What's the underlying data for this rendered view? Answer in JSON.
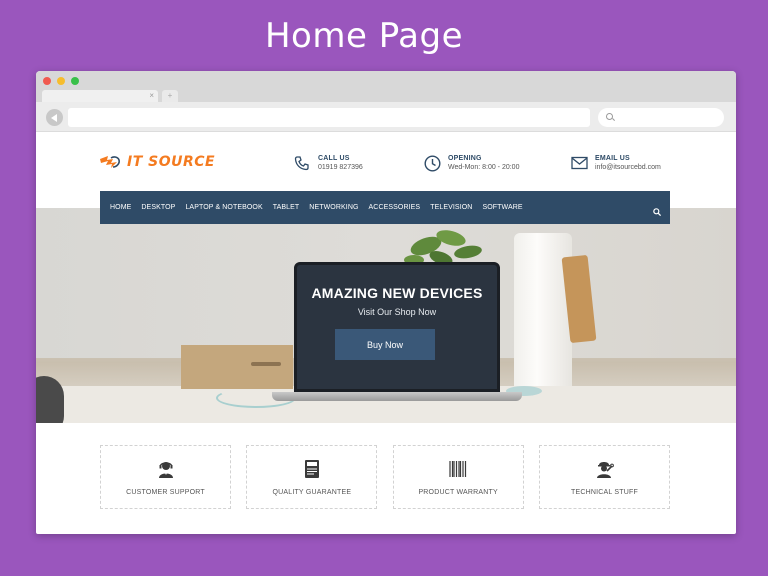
{
  "heading": "Home Page",
  "browser": {
    "tab_close": "×",
    "tab_new": "+"
  },
  "site": {
    "logo": {
      "mark": "ITS",
      "text": "IT SOURCE",
      "color": "#f47b20"
    },
    "contacts": [
      {
        "icon": "phone-icon",
        "label": "CALL US",
        "value": "01919 827396"
      },
      {
        "icon": "clock-icon",
        "label": "OPENING",
        "value": "Wed-Mon: 8:00 - 20:00"
      },
      {
        "icon": "envelope-icon",
        "label": "EMAIL US",
        "value": "info@itsourcebd.com"
      }
    ],
    "nav": {
      "items": [
        "HOME",
        "DESKTOP",
        "LAPTOP & NOTEBOOK",
        "TABLET",
        "NETWORKING",
        "ACCESSORIES",
        "TELEVISION",
        "SOFTWARE"
      ],
      "search_icon": "search-icon",
      "color": "#2f4b67"
    },
    "hero": {
      "title": "AMAZING NEW DEVICES",
      "subtitle": "Visit Our Shop Now",
      "button": "Buy Now",
      "button_color": "#3a5878"
    },
    "features": [
      {
        "icon": "headset-support-icon",
        "label": "CUSTOMER SUPPORT"
      },
      {
        "icon": "book-icon",
        "label": "QUALITY GUARANTEE"
      },
      {
        "icon": "barcode-icon",
        "label": "PRODUCT WARRANTY"
      },
      {
        "icon": "technician-icon",
        "label": "TECHNICAL STUFF"
      }
    ]
  },
  "colors": {
    "background": "#9a56bd",
    "accent": "#f47b20"
  }
}
